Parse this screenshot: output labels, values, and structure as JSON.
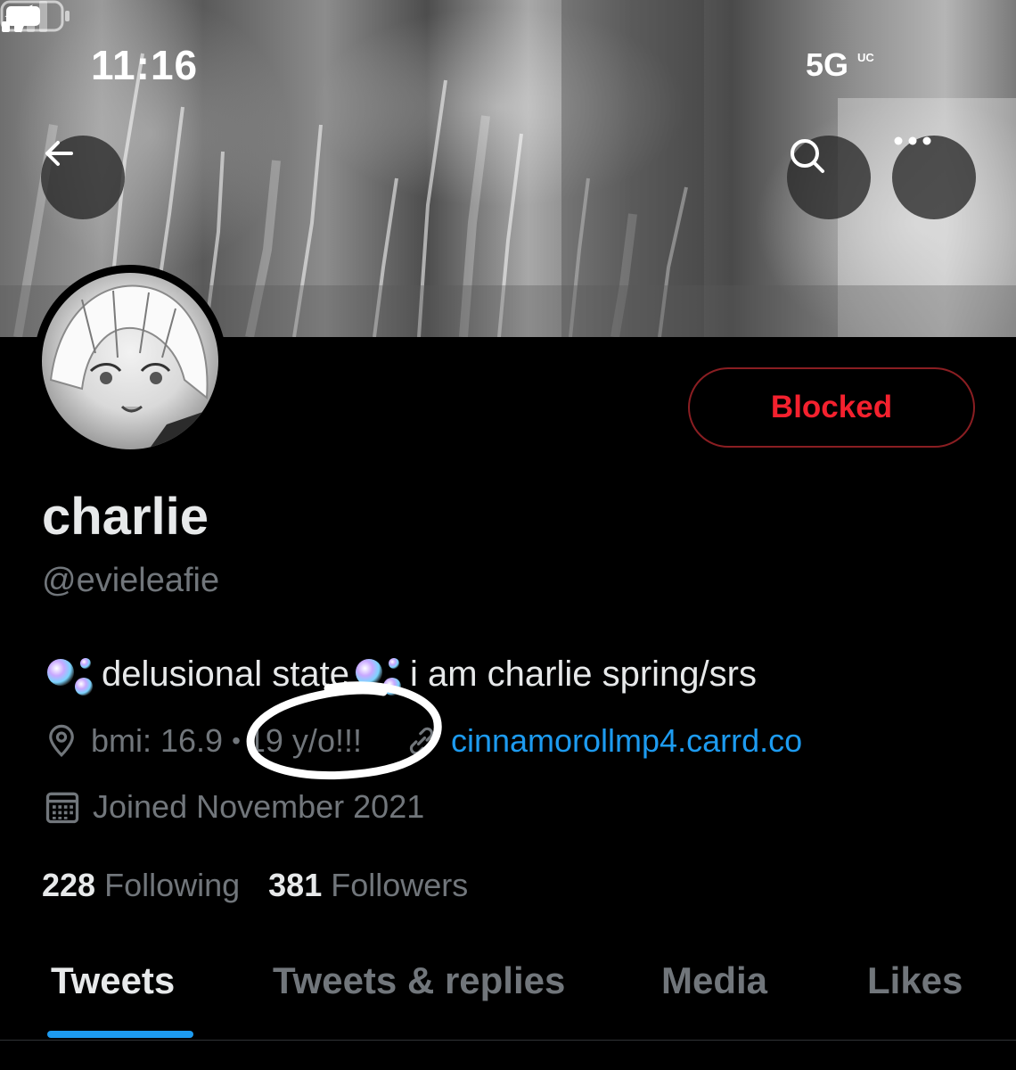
{
  "status_bar": {
    "time": "11:16",
    "network": "5G",
    "network_suffix": "UC",
    "icons": [
      "location-arrow-icon",
      "signal-icon",
      "battery-icon"
    ]
  },
  "header": {
    "back_icon": "back-arrow-icon",
    "search_icon": "search-icon",
    "more_icon": "more-icon"
  },
  "profile": {
    "blocked_label": "Blocked",
    "display_name": "charlie",
    "handle": "@evieleafie",
    "bio": {
      "part1": "delusional state",
      "part2": "i am charlie spring/srs",
      "emoji_icon": "bubbles-icon"
    },
    "location": "bmi: 16.9",
    "location_separator": "•",
    "age_note": "19 y/o!!!",
    "website": "cinnamorollmp4.carrd.co",
    "joined": "Joined November 2021",
    "following_count": "228",
    "following_label": "Following",
    "followers_count": "381",
    "followers_label": "Followers"
  },
  "tabs": [
    {
      "label": "Tweets",
      "active": true
    },
    {
      "label": "Tweets & replies",
      "active": false
    },
    {
      "label": "Media",
      "active": false
    },
    {
      "label": "Likes",
      "active": false
    }
  ],
  "colors": {
    "background": "#000000",
    "text_primary": "#e7e9ea",
    "text_secondary": "#71767b",
    "link": "#1d9bf0",
    "blocked_text": "#f4212e",
    "blocked_border": "#8a1e22",
    "tab_indicator": "#1d9bf0"
  }
}
